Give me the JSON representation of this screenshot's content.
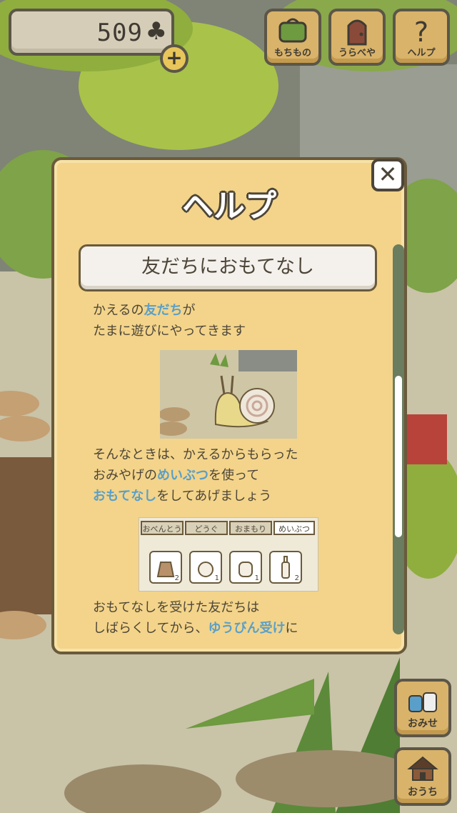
{
  "hud": {
    "clover_count": "509",
    "clover_symbol": "♣",
    "plus_symbol": "+"
  },
  "top_buttons": [
    {
      "label": "もちもの",
      "icon": "bag-icon"
    },
    {
      "label": "うらべや",
      "icon": "door-icon"
    },
    {
      "label": "ヘルプ",
      "icon": "question-icon"
    }
  ],
  "side_buttons": [
    {
      "label": "おみせ",
      "icon": "shop-icon"
    },
    {
      "label": "おうち",
      "icon": "house-icon"
    }
  ],
  "dialog": {
    "title": "ヘルプ",
    "close_symbol": "✕",
    "section_title": "友だちにおもてなし",
    "para1": {
      "line1_a": "かえるの",
      "line1_hl": "友だち",
      "line1_b": "が",
      "line2": "たまに遊びにやってきます"
    },
    "para2": {
      "line1": "そんなときは、かえるからもらった",
      "line2_a": "おみやげの",
      "line2_hl": "めいぶつ",
      "line2_b": "を使って",
      "line3_hl": "おもてなし",
      "line3_b": "をしてあげましょう"
    },
    "tabs": [
      "おべんとう",
      "どうぐ",
      "おまもり",
      "めいぶつ"
    ],
    "slot_counts": [
      "2",
      "1",
      "1",
      "2"
    ],
    "para3": {
      "line1": "おもてなしを受けた友だちは",
      "line2_a": "しばらくしてから、",
      "line2_hl": "ゆうびん受け",
      "line2_b": "に"
    }
  },
  "colors": {
    "highlight": "#5a9fc9",
    "dialog_bg": "#f3d48a",
    "button_bg": "#d9b36a"
  }
}
